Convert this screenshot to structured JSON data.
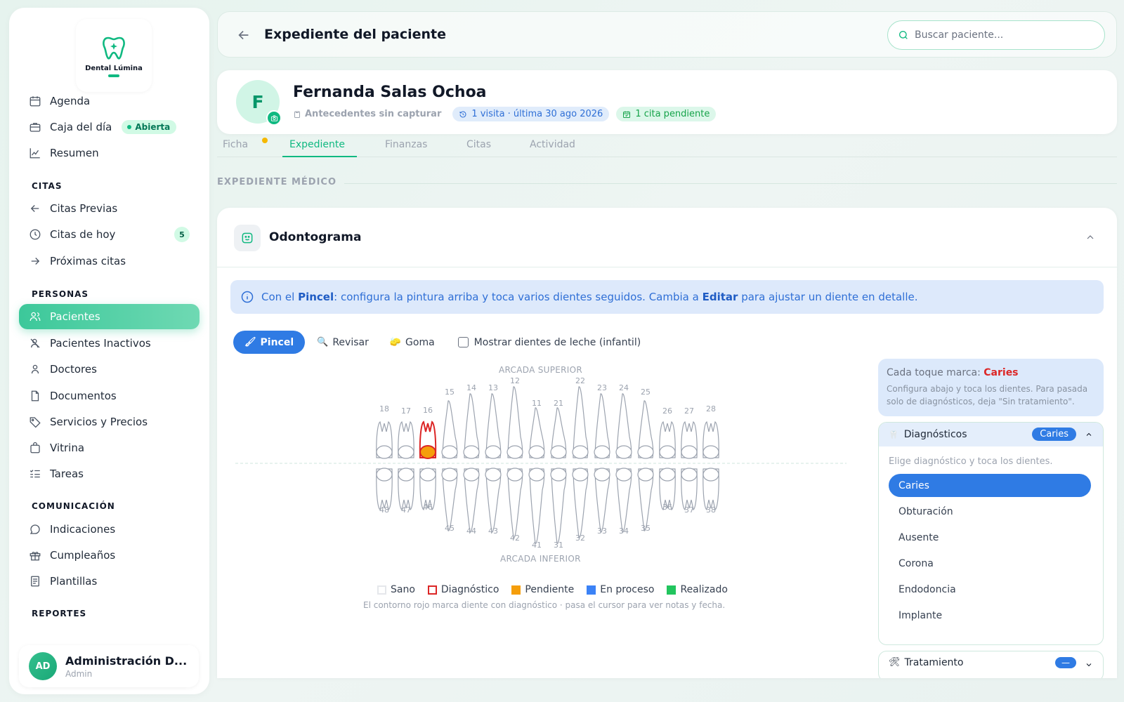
{
  "sidebar": {
    "logo_text": "Dental Lúmina",
    "items_top": [
      {
        "label": "Agenda",
        "icon": "calendar-icon"
      },
      {
        "label": "Caja del día",
        "icon": "briefcase-icon",
        "badge": "Abierta"
      },
      {
        "label": "Resumen",
        "icon": "chart-line-icon"
      }
    ],
    "sections": {
      "citas": "CITAS",
      "personas": "PERSONAS",
      "comunicacion": "COMUNICACIÓN",
      "reportes": "REPORTES"
    },
    "items_citas": [
      {
        "label": "Citas Previas",
        "icon": "arrow-left-icon"
      },
      {
        "label": "Citas de hoy",
        "icon": "clock-icon",
        "count": "5"
      },
      {
        "label": "Próximas citas",
        "icon": "arrow-right-icon"
      }
    ],
    "items_personas": [
      {
        "label": "Pacientes",
        "icon": "users-icon"
      },
      {
        "label": "Pacientes Inactivos",
        "icon": "user-x-icon"
      },
      {
        "label": "Doctores",
        "icon": "user-icon"
      },
      {
        "label": "Documentos",
        "icon": "file-icon"
      },
      {
        "label": "Servicios y Precios",
        "icon": "tag-icon"
      },
      {
        "label": "Vitrina",
        "icon": "shopping-bag-icon"
      },
      {
        "label": "Tareas",
        "icon": "list-check-icon"
      }
    ],
    "items_comunicacion": [
      {
        "label": "Indicaciones",
        "icon": "message-icon"
      },
      {
        "label": "Cumpleaños",
        "icon": "gift-icon"
      },
      {
        "label": "Plantillas",
        "icon": "document-icon"
      }
    ],
    "user": {
      "initials": "AD",
      "name": "Administración D...",
      "role": "Admin"
    }
  },
  "header": {
    "title": "Expediente del paciente",
    "search_placeholder": "Buscar paciente..."
  },
  "patient": {
    "initial": "F",
    "name": "Fernanda Salas Ochoa",
    "antecedentes": "Antecedentes sin capturar",
    "visits": "1 visita · última 30 ago 2026",
    "pending": "1 cita pendiente"
  },
  "tabs": [
    "Ficha",
    "Expediente",
    "Finanzas",
    "Citas",
    "Actividad"
  ],
  "section_heading": "EXPEDIENTE MÉDICO",
  "odontograma": {
    "title": "Odontograma",
    "banner": {
      "pre": "Con el ",
      "b1": "Pincel",
      "mid": ": configura la pintura arriba y toca varios dientes seguidos. Cambia a ",
      "b2": "Editar",
      "post": " para ajustar un diente en detalle."
    },
    "tools": {
      "pincel": "Pincel",
      "revisar": "Revisar",
      "goma": "Goma"
    },
    "checkbox_label": "Mostrar dientes de leche (infantil)",
    "arcada_superior": "ARCADA SUPERIOR",
    "arcada_inferior": "ARCADA INFERIOR",
    "upper_teeth": [
      "18",
      "17",
      "16",
      "15",
      "14",
      "13",
      "12",
      "11",
      "21",
      "22",
      "23",
      "24",
      "25",
      "26",
      "27",
      "28"
    ],
    "lower_teeth": [
      "48",
      "47",
      "46",
      "45",
      "44",
      "43",
      "42",
      "41",
      "31",
      "32",
      "33",
      "34",
      "35",
      "36",
      "37",
      "38"
    ],
    "diagnosed_tooth": "16",
    "legend": [
      {
        "label": "Sano",
        "color": "#ffffff",
        "border": "#e5e7eb"
      },
      {
        "label": "Diagnóstico",
        "color": "#ffffff",
        "border": "#dc2626"
      },
      {
        "label": "Pendiente",
        "color": "#f59e0b",
        "border": "#f59e0b"
      },
      {
        "label": "En proceso",
        "color": "#3b82f6",
        "border": "#3b82f6"
      },
      {
        "label": "Realizado",
        "color": "#22c55e",
        "border": "#22c55e"
      }
    ],
    "legend_note": "El contorno rojo marca diente con diagnóstico · pasa el cursor para ver notas y fecha."
  },
  "panel": {
    "hint_prefix": "Cada toque marca: ",
    "hint_value": "Caries",
    "hint_body": "Configura abajo y toca los dientes. Para pasada solo de diagnósticos, deja \"Sin tratamiento\".",
    "diag_title": "Diagnósticos",
    "diag_badge": "Caries",
    "diag_hint": "Elige diagnóstico y toca los dientes.",
    "diag_options": [
      "Caries",
      "Obturación",
      "Ausente",
      "Corona",
      "Endodoncia",
      "Implante"
    ],
    "treat_title": "Tratamiento",
    "treat_badge": "—"
  },
  "colors": {
    "accent": "#10b981",
    "blue": "#2f7be4",
    "diagnosis": "#dc2626",
    "caries_fill": "#f59e0b"
  }
}
